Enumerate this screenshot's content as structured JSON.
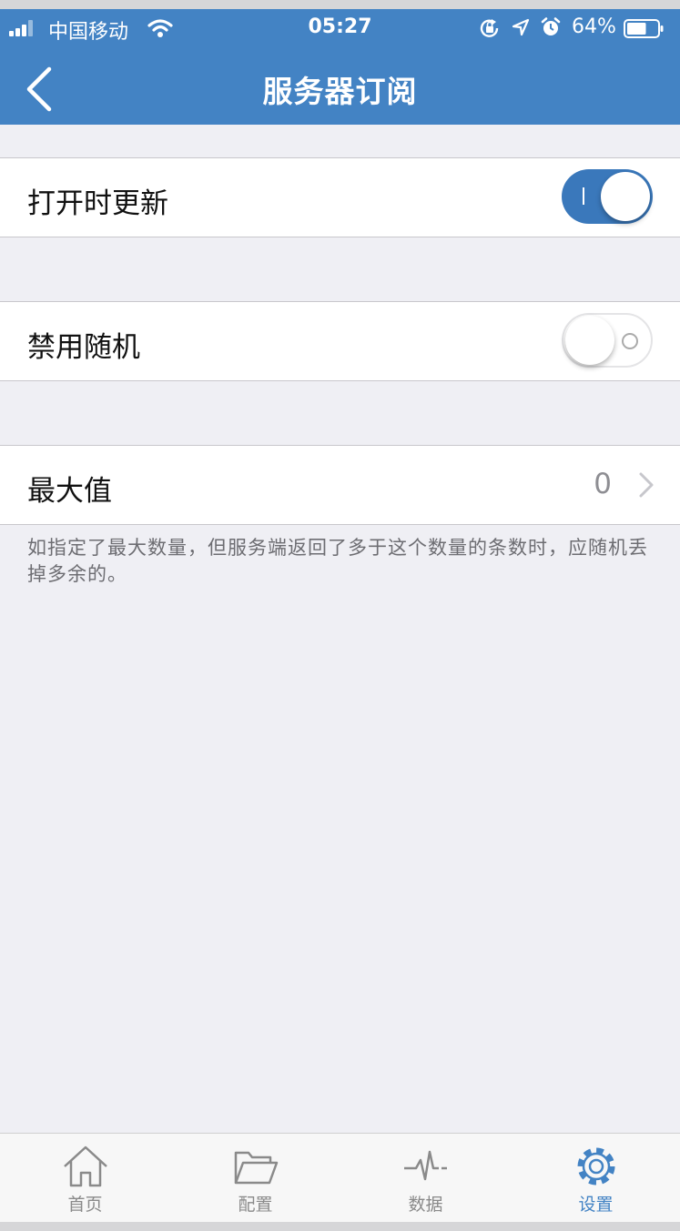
{
  "status_bar": {
    "carrier": "中国移动",
    "time": "05:27",
    "battery_percent": "64%",
    "battery_level": 0.64,
    "icons": [
      "signal-icon",
      "wifi-icon",
      "rotation-lock-icon",
      "location-arrow-icon",
      "alarm-icon",
      "battery-icon"
    ]
  },
  "nav": {
    "title": "服务器订阅",
    "back_icon": "chevron-left-icon"
  },
  "settings": {
    "update_on_open": {
      "label": "打开时更新",
      "enabled": true
    },
    "disable_random": {
      "label": "禁用随机",
      "enabled": false
    },
    "max_value": {
      "label": "最大值",
      "value": "0"
    },
    "footnote": "如指定了最大数量，但服务端返回了多于这个数量的条数时，应随机丢掉多余的。"
  },
  "tabbar": {
    "items": [
      {
        "label": "首页",
        "icon": "home-icon",
        "active": false
      },
      {
        "label": "配置",
        "icon": "folder-icon",
        "active": false
      },
      {
        "label": "数据",
        "icon": "pulse-icon",
        "active": false
      },
      {
        "label": "设置",
        "icon": "gear-icon",
        "active": true
      }
    ]
  },
  "colors": {
    "accent": "#4383c4",
    "background": "#efeff4",
    "toggle_on": "#3a78bb",
    "inactive_tab": "#8a8a8a"
  }
}
